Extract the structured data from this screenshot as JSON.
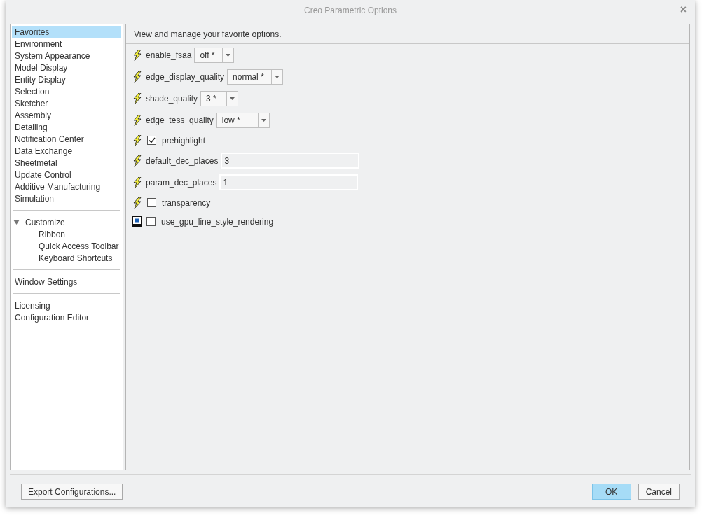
{
  "window": {
    "title": "Creo Parametric Options",
    "close": "×"
  },
  "sidebar": {
    "groups": [
      {
        "items": [
          {
            "label": "Favorites",
            "selected": true
          },
          {
            "label": "Environment",
            "selected": false
          },
          {
            "label": "System Appearance",
            "selected": false
          },
          {
            "label": "Model Display",
            "selected": false
          },
          {
            "label": "Entity Display",
            "selected": false
          },
          {
            "label": "Selection",
            "selected": false
          },
          {
            "label": "Sketcher",
            "selected": false
          },
          {
            "label": "Assembly",
            "selected": false
          },
          {
            "label": "Detailing",
            "selected": false
          },
          {
            "label": "Notification Center",
            "selected": false
          },
          {
            "label": "Data Exchange",
            "selected": false
          },
          {
            "label": "Sheetmetal",
            "selected": false
          },
          {
            "label": "Update Control",
            "selected": false
          },
          {
            "label": "Additive Manufacturing",
            "selected": false
          },
          {
            "label": "Simulation",
            "selected": false
          }
        ]
      },
      {
        "items": [
          {
            "label": "Customize",
            "selected": false,
            "expanded": true,
            "children": [
              {
                "label": "Ribbon",
                "selected": false
              },
              {
                "label": "Quick Access Toolbar",
                "selected": false
              },
              {
                "label": "Keyboard Shortcuts",
                "selected": false
              }
            ]
          }
        ]
      },
      {
        "items": [
          {
            "label": "Window Settings",
            "selected": false
          }
        ]
      },
      {
        "items": [
          {
            "label": "Licensing",
            "selected": false
          },
          {
            "label": "Configuration Editor",
            "selected": false
          }
        ]
      }
    ]
  },
  "main": {
    "heading": "View and manage your favorite options.",
    "options": [
      {
        "kind": "dropdown",
        "lightning": true,
        "name": "enable_fsaa",
        "value": "off *"
      },
      {
        "kind": "dropdown",
        "lightning": true,
        "name": "edge_display_quality",
        "value": "normal *"
      },
      {
        "kind": "dropdown",
        "lightning": true,
        "name": "shade_quality",
        "value": "3 *"
      },
      {
        "kind": "dropdown",
        "lightning": true,
        "name": "edge_tess_quality",
        "value": "low *"
      },
      {
        "kind": "checkbox",
        "lightning": true,
        "name": "prehighlight",
        "checked": true
      },
      {
        "kind": "text",
        "lightning": true,
        "name": "default_dec_places",
        "value": "3"
      },
      {
        "kind": "text",
        "lightning": true,
        "name": "param_dec_places",
        "value": "1"
      },
      {
        "kind": "checkbox",
        "lightning": true,
        "name": "transparency",
        "checked": false
      },
      {
        "kind": "checkbox",
        "lightning": false,
        "name": "use_gpu_line_style_rendering",
        "checked": false
      }
    ]
  },
  "footer": {
    "left_button": "Export Configurations...",
    "buttons": [
      {
        "label": "OK",
        "selected": true
      },
      {
        "label": "Cancel",
        "selected": false
      }
    ]
  }
}
